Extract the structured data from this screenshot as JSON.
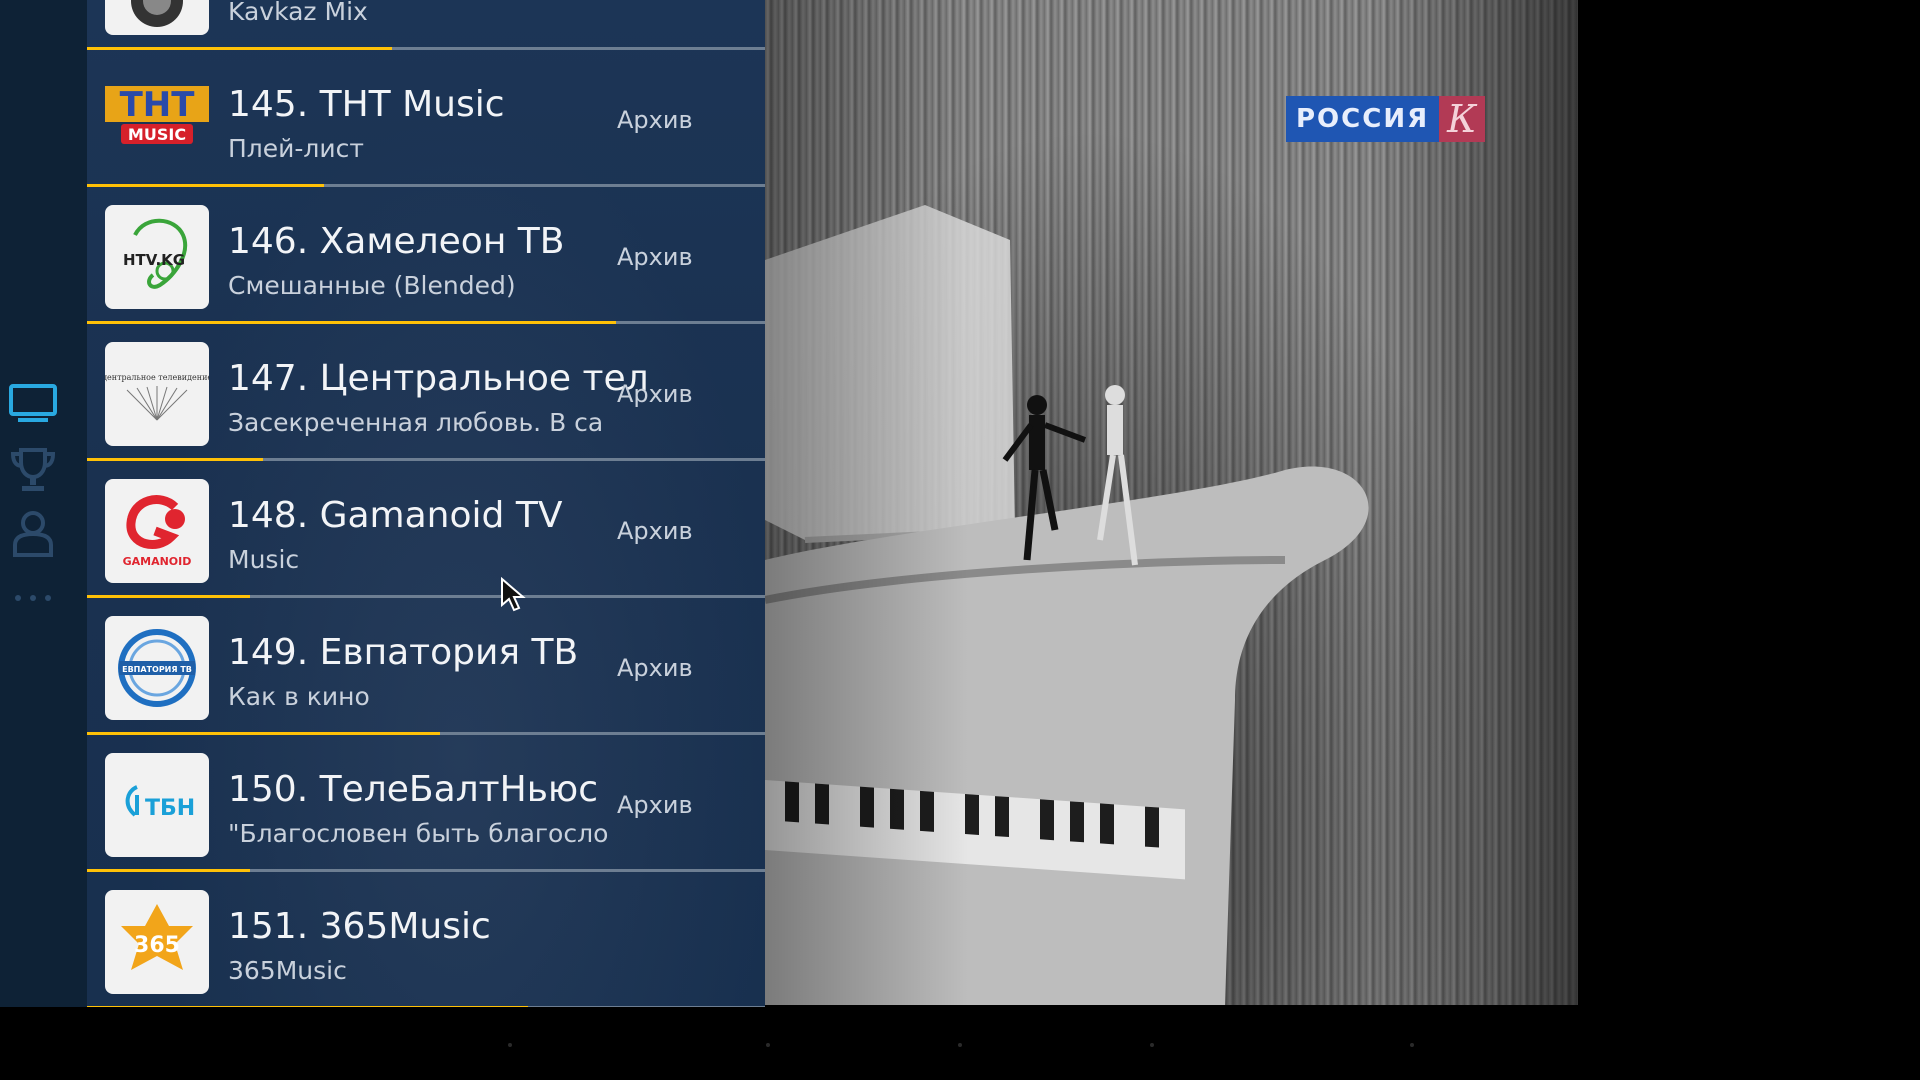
{
  "rail": {
    "icons": [
      "tv-icon",
      "trophy-icon",
      "profile-icon",
      "more-icon"
    ],
    "active_color": "#29a9e1"
  },
  "channels": [
    {
      "title": "Kavkaz Mix",
      "subtitle": "",
      "archive": "",
      "progress": 0.45
    },
    {
      "title": "145. ТНТ Music",
      "subtitle": "Плей-лист",
      "archive": "Архив",
      "progress": 0.35
    },
    {
      "title": "146. Хамелеон ТВ",
      "subtitle": "Смешанные (Blended)",
      "archive": "Архив",
      "progress": 0.78
    },
    {
      "title": "147. Центральное тел",
      "subtitle": "Засекреченная любовь. В са",
      "archive": "Архив",
      "progress": 0.26
    },
    {
      "title": "148. Gamanoid TV",
      "subtitle": "Music",
      "archive": "Архив",
      "progress": 0.24
    },
    {
      "title": "149. Евпатория ТВ",
      "subtitle": "Как в кино",
      "archive": "Архив",
      "progress": 0.52
    },
    {
      "title": "150. ТелеБалтНьюс",
      "subtitle": "\"Благословен быть благосло",
      "archive": "Архив",
      "progress": 0.24
    },
    {
      "title": "151. 365Music",
      "subtitle": "365Music",
      "archive": "",
      "progress": 0.65
    }
  ],
  "logos": {
    "tnt": {
      "line1": "ТНТ",
      "line2": "MUSIC"
    },
    "hameleon": {
      "text": "HTV.KG"
    },
    "central": {
      "text": "центральное телевидение"
    },
    "gamanoid": {
      "text": "GAMANOID"
    },
    "evpatoria": {
      "text": "ЕВПАТОРИЯ ТВ"
    },
    "tbn": {
      "text": "ТБН"
    },
    "music365": {
      "text": "365"
    }
  },
  "player": {
    "logo_main": "РОССИЯ",
    "logo_letter": "К"
  },
  "colors": {
    "accent": "#ffc107",
    "list_bg": "#1a3150",
    "rail_bg": "#0e2236"
  }
}
